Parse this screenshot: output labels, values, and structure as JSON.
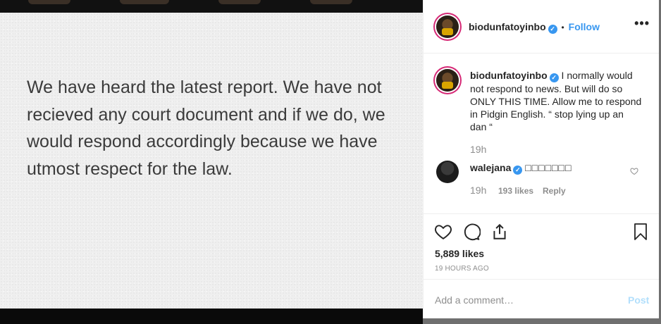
{
  "media": {
    "text": "We have heard the latest report. We have not recieved any court document and if we do, we would respond accordingly because we have utmost respect for the law."
  },
  "header": {
    "username": "biodunfatoyinbo",
    "separator": "•",
    "follow_label": "Follow",
    "more_label": "•••"
  },
  "caption": {
    "username": "biodunfatoyinbo",
    "text": "I normally would not respond to news. But will do so ONLY THIS TIME. Allow me to respond in Pidgin English. “ stop lying up an dan “",
    "time": "19h"
  },
  "comment": {
    "username": "walejana",
    "text": "□□□□□□□",
    "time": "19h",
    "likes": "193 likes",
    "reply_label": "Reply"
  },
  "post_stats": {
    "likes": "5,889 likes",
    "time_ago": "19 HOURS AGO"
  },
  "composer": {
    "placeholder": "Add a comment…",
    "post_label": "Post"
  },
  "icons": {
    "verified": "verified-badge-icon",
    "like": "heart-icon",
    "comment": "comment-bubble-icon",
    "share": "share-icon",
    "save": "bookmark-icon"
  },
  "colors": {
    "link": "#3897f0",
    "verified": "#3897f0",
    "muted": "#8e8e8e",
    "post_disabled": "#b2dffc"
  }
}
